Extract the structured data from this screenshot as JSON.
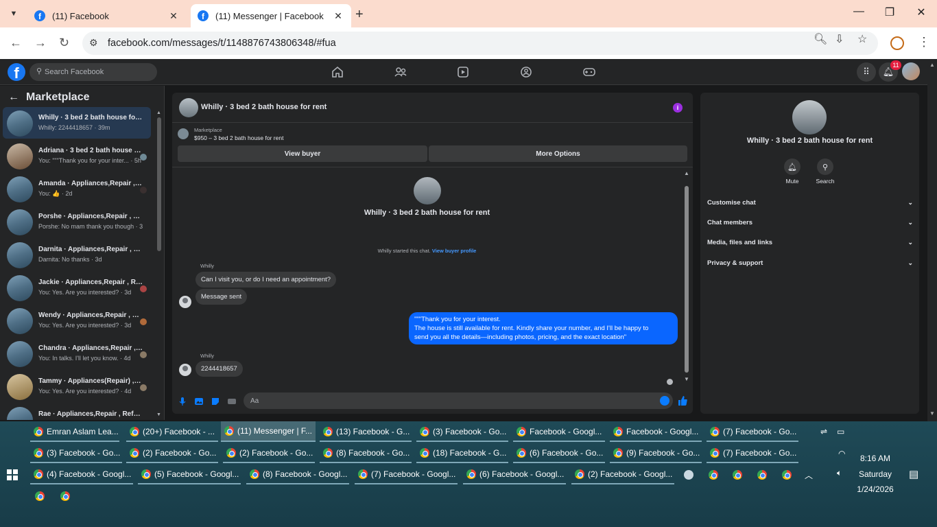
{
  "browser": {
    "tabs": [
      {
        "title": "(11) Facebook",
        "active": false
      },
      {
        "title": "(11) Messenger | Facebook",
        "active": true
      }
    ],
    "url": "facebook.com/messages/t/1148876743806348/#fua"
  },
  "fb_header": {
    "search_placeholder": "Search Facebook",
    "notification_count": "11"
  },
  "sidebar": {
    "title": "Marketplace",
    "conversations": [
      {
        "title": "Whilly · 3 bed 2 bath house for rent",
        "sub": "Whilly: 2244418657 · 39m",
        "selected": true
      },
      {
        "title": "Adriana · 3 bed 2 bath house for rent",
        "sub": "You: \"\"\"Thank you for your inter... · 5h"
      },
      {
        "title": "Amanda · Appliances,Repair , Refrigerator",
        "sub": "You: 👍 · 2d"
      },
      {
        "title": "Porshe · Appliances,Repair , Refrigerator",
        "sub": "Porshe: No mam thank you though · 3d"
      },
      {
        "title": "Darnita · Appliances,Repair , Refrigerator",
        "sub": "Darnita: No thanks · 3d"
      },
      {
        "title": "Jackie · Appliances,Repair , Refrigerator",
        "sub": "You: Yes. Are you interested? · 3d"
      },
      {
        "title": "Wendy · Appliances,Repair , Refrigerator",
        "sub": "You: Yes. Are you interested? · 3d"
      },
      {
        "title": "Chandra · Appliances,Repair , Refrigerator",
        "sub": "You: In talks. I'll let you know. · 4d"
      },
      {
        "title": "Tammy · Appliances(Repair) , Refrigerator",
        "sub": "You: Yes. Are you interested? · 4d"
      },
      {
        "title": "Rae · Appliances,Repair , Refrigerator",
        "sub": ""
      }
    ]
  },
  "chat": {
    "header_title": "Whilly · 3 bed 2 bath house for rent",
    "marketplace_label": "Marketplace",
    "listing": "$950 – 3 bed 2 bath house for rent",
    "view_buyer": "View buyer",
    "more_options": "More Options",
    "hero_name": "Whilly · 3 bed 2 bath house for rent",
    "started_text": "Whilly started this chat.",
    "view_buyer_profile": "View buyer profile",
    "messages": [
      {
        "sender": "Whilly",
        "text": "Can I visit you, or do I need an appointment?"
      },
      {
        "text": "Message sent"
      },
      {
        "outgoing": true,
        "text": "\"\"\"Thank you for your interest.\nThe house is still available for rent. Kindly share your number, and I'll be happy to\nsend you all the details—including photos, pricing, and the exact location\""
      },
      {
        "sender": "Whilly",
        "text": "2244418657"
      }
    ],
    "composer_placeholder": "Aa"
  },
  "info_panel": {
    "name": "Whilly · 3 bed 2 bath house for rent",
    "mute_label": "Mute",
    "search_label": "Search",
    "sections": [
      "Customise chat",
      "Chat members",
      "Media, files and links",
      "Privacy & support"
    ]
  },
  "taskbar": {
    "row1": [
      "Emran Aslam Lea...",
      "(20+) Facebook - ...",
      "(11) Messenger | F...",
      "(13) Facebook - G...",
      "(3) Facebook - Go...",
      "Facebook - Googl...",
      "Facebook - Googl...",
      "(7) Facebook - Go..."
    ],
    "row2": [
      "(3) Facebook - Go...",
      "(2) Facebook - Go...",
      "(2) Facebook - Go...",
      "(8) Facebook - Go...",
      "(18) Facebook - G...",
      "(6) Facebook - Go...",
      "(9) Facebook - Go...",
      "(7) Facebook - Go..."
    ],
    "row3": [
      "(4) Facebook - Googl...",
      "(5) Facebook - Googl...",
      "(8) Facebook - Googl...",
      "(7) Facebook - Googl...",
      "(6) Facebook - Googl...",
      "(2) Facebook - Googl..."
    ],
    "time": "8:16 AM",
    "day": "Saturday",
    "date": "1/24/2026"
  },
  "colors": {
    "accent": "#0a66ff",
    "fb_blue": "#1877f2",
    "bg": "#18191a",
    "panel": "#242526",
    "taskbar": "#1f4a57"
  },
  "icons": [
    "search-icon",
    "home-icon",
    "friends-icon",
    "video-icon",
    "groups-icon",
    "gaming-icon",
    "menu-grid-icon",
    "bell-icon",
    "info-icon",
    "mic-icon",
    "photo-icon",
    "sticker-icon",
    "gif-icon",
    "emoji-icon",
    "like-icon",
    "chevron-down-icon",
    "windows-start-icon",
    "chrome-icon"
  ]
}
